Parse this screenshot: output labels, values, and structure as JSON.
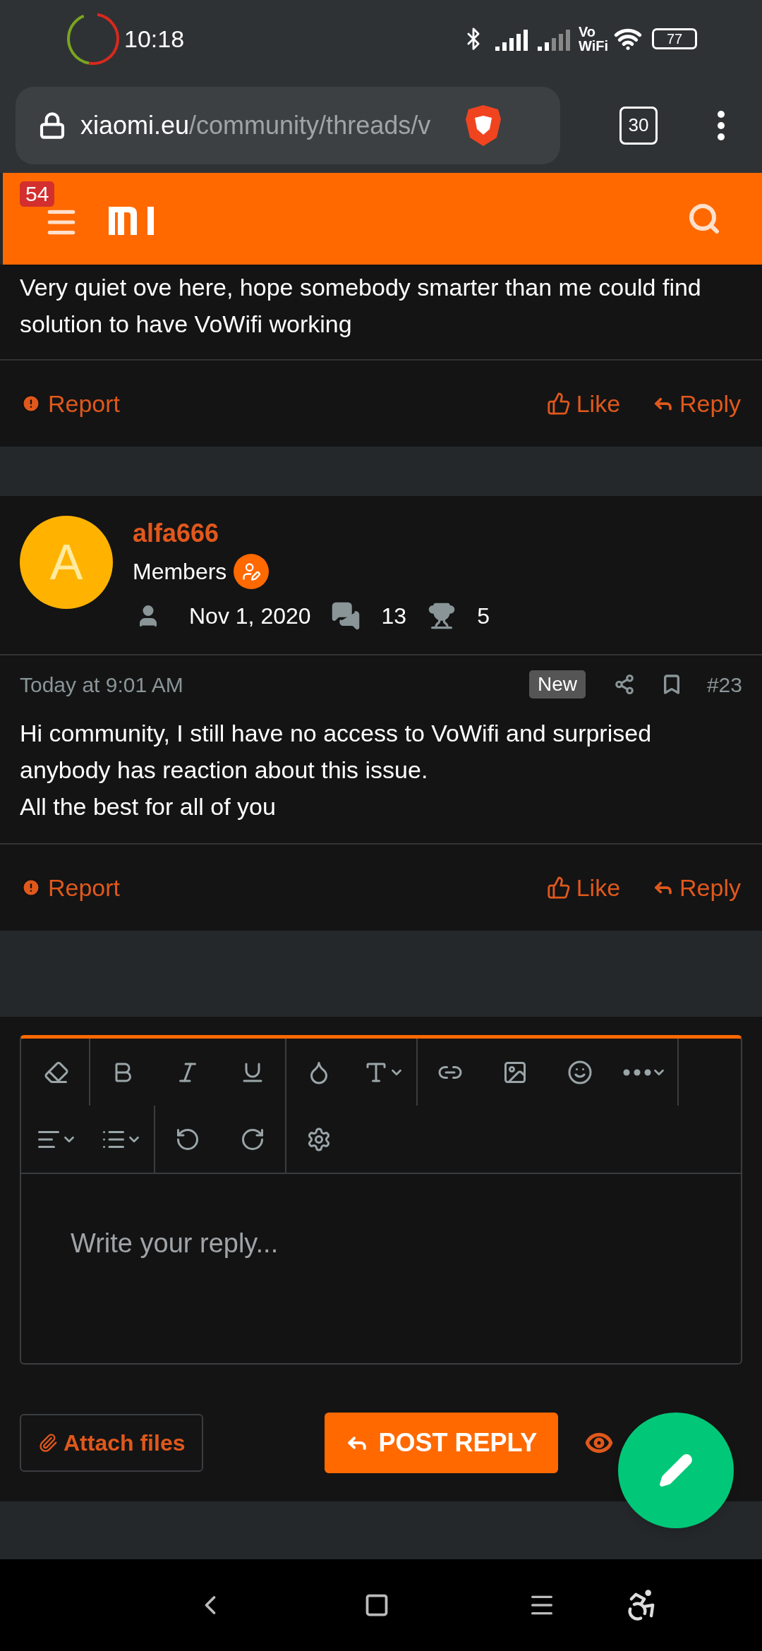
{
  "status_bar": {
    "time": "10:18",
    "vowifi": [
      "Vo",
      "WiFi"
    ],
    "battery": "77"
  },
  "browser": {
    "url_domain": "xiaomi.eu",
    "url_path": "/community/threads/v",
    "tab_count": "30"
  },
  "site_header": {
    "notification_count": "54"
  },
  "previous_post": {
    "body": "Very quiet ove here, hope somebody smarter than me could find solution to have VoWifi working",
    "actions": [
      "Report",
      "Like",
      "Reply"
    ]
  },
  "post": {
    "avatar_letter": "A",
    "author": "alfa666",
    "role": "Members",
    "joined": "Nov 1, 2020",
    "messages": "13",
    "points": "5",
    "time": "Today at 9:01 AM",
    "badge": "New",
    "number": "#23",
    "body": [
      "Hi community, I still have no access to VoWifi and surprised anybody has reaction about this issue.",
      "All the best for all of you"
    ],
    "actions": [
      "Report",
      "Like",
      "Reply"
    ]
  },
  "editor": {
    "placeholder": "Write your reply...",
    "attach_button": "Attach files",
    "post_button": "POST REPLY"
  }
}
